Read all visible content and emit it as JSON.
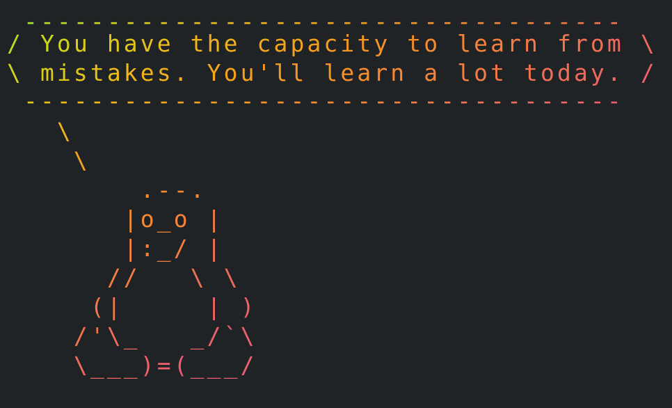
{
  "bubble": {
    "top_border": " ------------------------------------",
    "line1": "/ You have the capacity to learn from \\",
    "line2": "\\ mistakes. You'll learn a lot today. /",
    "bottom_border": " ------------------------------------"
  },
  "tux": {
    "lines": [
      "   \\",
      "    \\",
      "        .--.",
      "       |o_o |",
      "       |:_/ |",
      "      //   \\ \\",
      "     (|     | )",
      "    /'\\_   _/`\\",
      "    \\___)=(___/"
    ]
  },
  "colors": {
    "background": "#1f2326",
    "gradient": [
      "#a6e22e",
      "#d4d21c",
      "#f0b81a",
      "#f4a21c",
      "#f78f2a",
      "#f77e3e",
      "#f26b5b",
      "#ee5e70"
    ]
  }
}
